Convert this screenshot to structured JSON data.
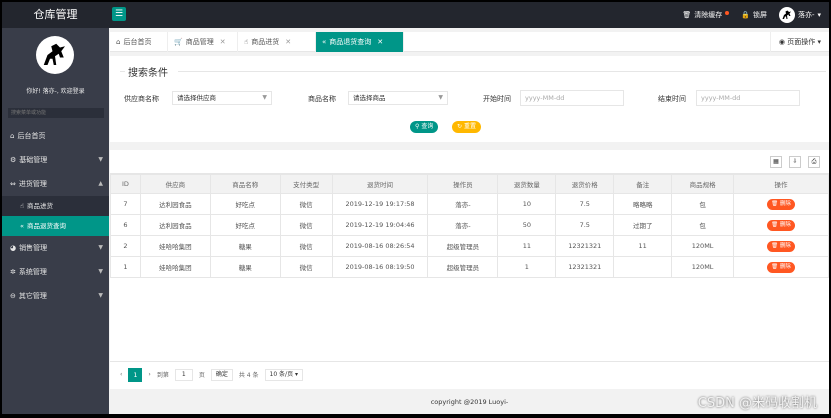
{
  "app": {
    "logo": "仓库管理"
  },
  "header": {
    "clear_cache": "清除缓存",
    "lock": "锁屏",
    "user": "落亦-",
    "user_caret": "▾"
  },
  "sidebar": {
    "welcome": "你好! 落亦-, 欢迎登录",
    "search_placeholder": "搜索菜单或功能",
    "items": [
      {
        "label": "后台首页",
        "icon": "home-icon"
      },
      {
        "label": "基础管理",
        "icon": "base-icon",
        "arrow": "▼"
      },
      {
        "label": "进货管理",
        "icon": "purchase-icon",
        "arrow": "▲"
      },
      {
        "label": "销售管理",
        "icon": "sales-icon",
        "arrow": "▼"
      },
      {
        "label": "系统管理",
        "icon": "system-icon",
        "arrow": "▼"
      },
      {
        "label": "其它管理",
        "icon": "other-icon",
        "arrow": "▼"
      }
    ],
    "sub_items": [
      {
        "label": "商品进货"
      },
      {
        "label": "商品退货查询"
      }
    ]
  },
  "tabs": [
    {
      "label": "后台首页"
    },
    {
      "label": "商品管理"
    },
    {
      "label": "商品进货"
    },
    {
      "label": "商品退货查询"
    }
  ],
  "page_ops": "页面操作",
  "search": {
    "legend": "搜索条件",
    "provider_label": "供应商名称",
    "provider_value": "请选择供应商",
    "goods_label": "商品名称",
    "goods_value": "请选择商品",
    "start_label": "开始时间",
    "start_placeholder": "yyyy-MM-dd",
    "end_label": "结束时间",
    "end_placeholder": "yyyy-MM-dd",
    "search_btn": "查询",
    "reset_btn": "重置"
  },
  "table": {
    "headers": [
      "ID",
      "供应商",
      "商品名称",
      "支付类型",
      "退货时间",
      "操作员",
      "退货数量",
      "退货价格",
      "备注",
      "商品规格",
      "操作"
    ],
    "rows": [
      [
        "7",
        "达利园食品",
        "好吃点",
        "微信",
        "2019-12-19 19:17:58",
        "落亦-",
        "10",
        "7.5",
        "略略略",
        "包"
      ],
      [
        "6",
        "达利园食品",
        "好吃点",
        "微信",
        "2019-12-19 19:04:46",
        "落亦-",
        "50",
        "7.5",
        "过期了",
        "包"
      ],
      [
        "2",
        "娃哈哈集团",
        "糖果",
        "微信",
        "2019-08-16 08:26:54",
        "超级管理员",
        "11",
        "12321321",
        "11",
        "120ML"
      ],
      [
        "1",
        "娃哈哈集团",
        "糖果",
        "微信",
        "2019-08-16 08:19:50",
        "超级管理员",
        "1",
        "12321321",
        "",
        "120ML"
      ]
    ],
    "delete_label": "删除"
  },
  "pager": {
    "current": "1",
    "goto_label": "到第",
    "goto_value": "1",
    "page_unit": "页",
    "confirm": "确定",
    "total": "共 4 条",
    "per_page": "10 条/页"
  },
  "footer": "copyright @2019 Luoyi-",
  "watermark": "CSDN @米码收割机",
  "colors": {
    "accent": "#009688",
    "danger": "#ff5722",
    "warn": "#ffb800",
    "dark": "#393d49"
  }
}
